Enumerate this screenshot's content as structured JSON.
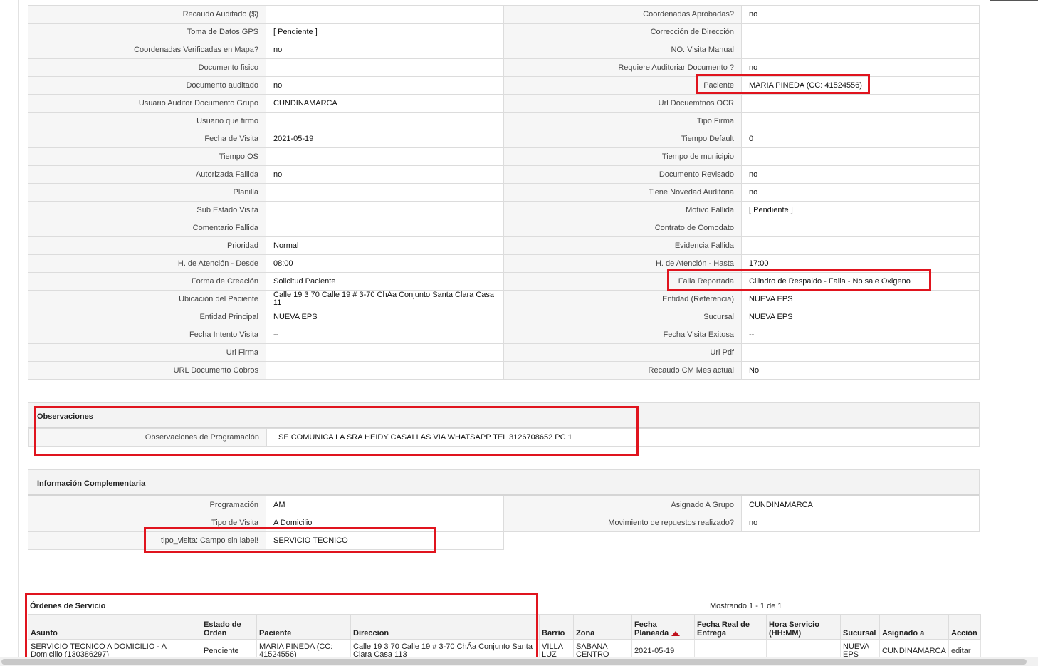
{
  "main_rows": [
    {
      "l1": "Recaudo Auditado ($)",
      "v1": "",
      "l2": "Coordenadas Aprobadas?",
      "v2": "no"
    },
    {
      "l1": "Toma de Datos GPS",
      "v1": "[ Pendiente ]",
      "l2": "Corrección de Dirección",
      "v2": ""
    },
    {
      "l1": "Coordenadas Verificadas en Mapa?",
      "v1": "no",
      "l2": "NO. Visita Manual",
      "v2": ""
    },
    {
      "l1": "Documento fisico",
      "v1": "",
      "l2": "Requiere Auditoriar Documento ?",
      "v2": "no"
    },
    {
      "l1": "Documento auditado",
      "v1": "no",
      "l2": "Paciente",
      "v2": "MARIA PINEDA (CC: 41524556)"
    },
    {
      "l1": "Usuario Auditor Documento Grupo",
      "v1": "CUNDINAMARCA",
      "l2": "Url Docuemtnos OCR",
      "v2": ""
    },
    {
      "l1": "Usuario que firmo",
      "v1": "",
      "l2": "Tipo Firma",
      "v2": ""
    },
    {
      "l1": "Fecha de Visita",
      "v1": "2021-05-19",
      "l2": "Tiempo Default",
      "v2": "0"
    },
    {
      "l1": "Tiempo OS",
      "v1": "",
      "l2": "Tiempo de municipio",
      "v2": ""
    },
    {
      "l1": "Autorizada Fallida",
      "v1": "no",
      "l2": "Documento Revisado",
      "v2": "no"
    },
    {
      "l1": "Planilla",
      "v1": "",
      "l2": "Tiene Novedad Auditoria",
      "v2": "no"
    },
    {
      "l1": "Sub Estado Visita",
      "v1": "",
      "l2": "Motivo Fallida",
      "v2": "[ Pendiente ]"
    },
    {
      "l1": "Comentario Fallida",
      "v1": "",
      "l2": "Contrato de Comodato",
      "v2": ""
    },
    {
      "l1": "Prioridad",
      "v1": "Normal",
      "l2": "Evidencia Fallida",
      "v2": ""
    },
    {
      "l1": "H. de Atención - Desde",
      "v1": "08:00",
      "l2": "H. de Atención - Hasta",
      "v2": "17:00"
    },
    {
      "l1": "Forma de Creación",
      "v1": "Solicitud Paciente",
      "l2": "Falla Reportada",
      "v2": "Cilindro de Respaldo - Falla - No sale Oxigeno"
    },
    {
      "l1": "Ubicación del Paciente",
      "v1": "Calle 19 3 70 Calle 19 # 3-70 ChÃa Conjunto Santa Clara Casa 11",
      "l2": "Entidad (Referencia)",
      "v2": "NUEVA EPS"
    },
    {
      "l1": "Entidad Principal",
      "v1": "NUEVA EPS",
      "l2": "Sucursal",
      "v2": "NUEVA EPS"
    },
    {
      "l1": "Fecha Intento Visita",
      "v1": "--",
      "l2": "Fecha Visita Exitosa",
      "v2": "--"
    },
    {
      "l1": "Url Firma",
      "v1": "",
      "l2": "Url Pdf",
      "v2": ""
    },
    {
      "l1": "URL Documento Cobros",
      "v1": "",
      "l2": "Recaudo CM Mes actual",
      "v2": "No"
    }
  ],
  "observaciones": {
    "title": "Observaciones",
    "label": "Observaciones de Programación",
    "value": "SE COMUNICA LA SRA HEIDY CASALLAS VIA WHATSAPP TEL 3126708652 PC 1"
  },
  "complementaria": {
    "title": "Información Complementaria",
    "rows": [
      {
        "l1": "Programación",
        "v1": "AM",
        "l2": "Asignado A Grupo",
        "v2": "CUNDINAMARCA"
      },
      {
        "l1": "Tipo de Visita",
        "v1": "A Domicilio",
        "l2": "Movimiento de repuestos realizado?",
        "v2": "no"
      }
    ],
    "extra": {
      "label": "tipo_visita: Campo sin label!",
      "value": "SERVICIO TECNICO"
    }
  },
  "ordenes": {
    "title": "Órdenes de Servicio",
    "count_text": "Mostrando 1 - 1 de 1",
    "headers": [
      "Asunto",
      "Estado de Orden",
      "Paciente",
      "Direccion",
      "Barrio",
      "Zona",
      "Fecha Planeada",
      "Fecha Real de Entrega",
      "Hora Servicio (HH:MM)",
      "Sucursal",
      "Asignado a",
      "Acción"
    ],
    "rows": [
      [
        "SERVICIO TECNICO A DOMICILIO - A Domicilio (130386297)",
        "Pendiente",
        "MARIA PINEDA (CC: 41524556)",
        "Calle 19 3 70 Calle 19 # 3-70 ChÃa Conjunto Santa Clara Casa 113",
        "VILLA LUZ",
        "SABANA CENTRO",
        "2021-05-19",
        "",
        "",
        "NUEVA EPS",
        "CUNDINAMARCA",
        "editar"
      ]
    ]
  }
}
